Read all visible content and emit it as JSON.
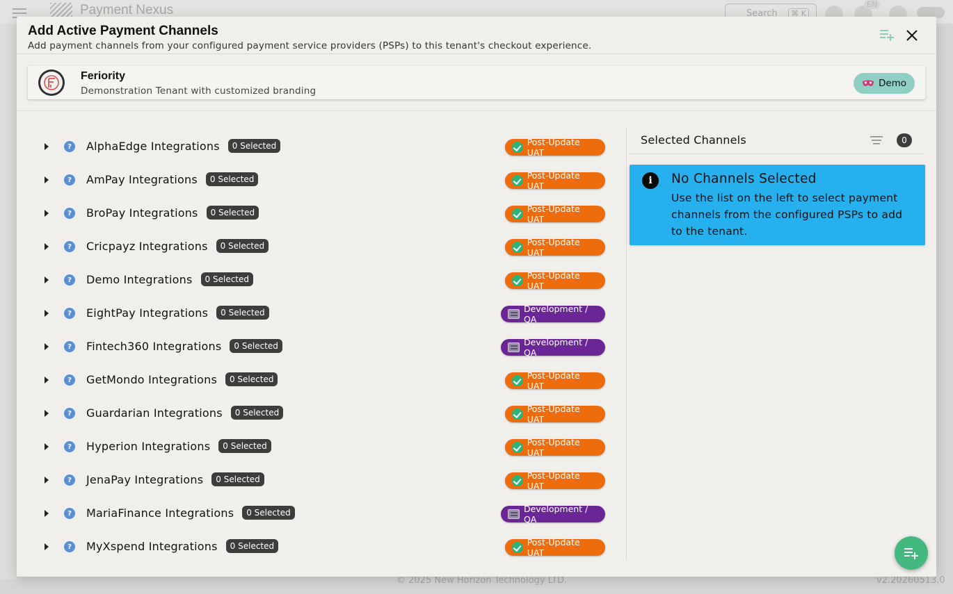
{
  "background": {
    "brand": "Payment Nexus",
    "search_placeholder": "Search",
    "search_shortcut": "⌘ K",
    "language": "EN",
    "copyright": "© 2025 New Horizon Technology LTD.",
    "version": "v2.20260513.0"
  },
  "modal": {
    "title": "Add Active Payment Channels",
    "subtitle": "Add payment channels from your configured payment service providers (PSPs) to this tenant's checkout experience."
  },
  "tenant": {
    "name": "Feriority",
    "description": "Demonstration Tenant with customized branding",
    "badge": "Demo"
  },
  "psps": [
    {
      "name": "AlphaEdge Integrations",
      "selected": "0 Selected",
      "env": "Post-Update UAT",
      "env_type": "uat"
    },
    {
      "name": "AmPay Integrations",
      "selected": "0 Selected",
      "env": "Post-Update UAT",
      "env_type": "uat"
    },
    {
      "name": "BroPay Integrations",
      "selected": "0 Selected",
      "env": "Post-Update UAT",
      "env_type": "uat"
    },
    {
      "name": "Cricpayz Integrations",
      "selected": "0 Selected",
      "env": "Post-Update UAT",
      "env_type": "uat"
    },
    {
      "name": "Demo Integrations",
      "selected": "0 Selected",
      "env": "Post-Update UAT",
      "env_type": "uat"
    },
    {
      "name": "EightPay Integrations",
      "selected": "0 Selected",
      "env": "Development / QA",
      "env_type": "dev"
    },
    {
      "name": "Fintech360 Integrations",
      "selected": "0 Selected",
      "env": "Development / QA",
      "env_type": "dev"
    },
    {
      "name": "GetMondo Integrations",
      "selected": "0 Selected",
      "env": "Post-Update UAT",
      "env_type": "uat"
    },
    {
      "name": "Guardarian Integrations",
      "selected": "0 Selected",
      "env": "Post-Update UAT",
      "env_type": "uat"
    },
    {
      "name": "Hyperion Integrations",
      "selected": "0 Selected",
      "env": "Post-Update UAT",
      "env_type": "uat"
    },
    {
      "name": "JenaPay Integrations",
      "selected": "0 Selected",
      "env": "Post-Update UAT",
      "env_type": "uat"
    },
    {
      "name": "MariaFinance Integrations",
      "selected": "0 Selected",
      "env": "Development / QA",
      "env_type": "dev"
    },
    {
      "name": "MyXspend Integrations",
      "selected": "0 Selected",
      "env": "Post-Update UAT",
      "env_type": "uat"
    }
  ],
  "selected_panel": {
    "title": "Selected Channels",
    "count": "0",
    "empty_title": "No Channels Selected",
    "empty_text": "Use the list on the left to select payment channels from the configured PSPs to add to the tenant."
  },
  "colors": {
    "uat": "#ec6c0e",
    "dev": "#6b2596",
    "info": "#27b0ee",
    "fab": "#43b97f",
    "demo_chip": "#8fcfc4"
  }
}
